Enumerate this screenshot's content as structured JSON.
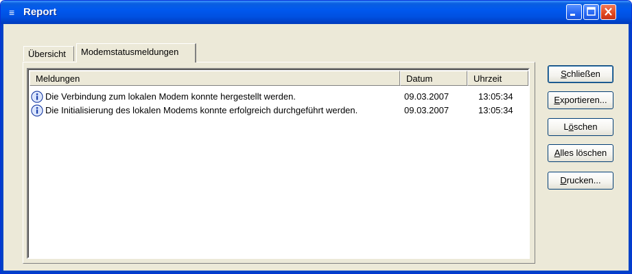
{
  "window": {
    "title": "Report",
    "icon": "report-icon",
    "accent": "#0058ee",
    "close_color": "#e2471e"
  },
  "tabs": [
    {
      "label": "Übersicht",
      "active": false
    },
    {
      "label": "Modemstatusmeldungen",
      "active": true
    }
  ],
  "list": {
    "columns": [
      "Meldungen",
      "Datum",
      "Uhrzeit"
    ],
    "rows": [
      {
        "icon": "info-icon",
        "message": "Die Verbindung zum lokalen Modem konnte hergestellt werden.",
        "date": "09.03.2007",
        "time": "13:05:34"
      },
      {
        "icon": "info-icon",
        "message": "Die Initialisierung des lokalen Modems konnte erfolgreich durchgeführt werden.",
        "date": "09.03.2007",
        "time": "13:05:34"
      }
    ]
  },
  "buttons": {
    "close": {
      "mnemonic": "S",
      "rest": "chließen"
    },
    "export": {
      "mnemonic": "E",
      "rest": "xportieren..."
    },
    "delete": {
      "pre": "L",
      "mnemonic": "ö",
      "rest": "schen"
    },
    "delete_all": {
      "mnemonic": "A",
      "rest": "lles löschen"
    },
    "print": {
      "mnemonic": "D",
      "rest": "rucken..."
    }
  }
}
